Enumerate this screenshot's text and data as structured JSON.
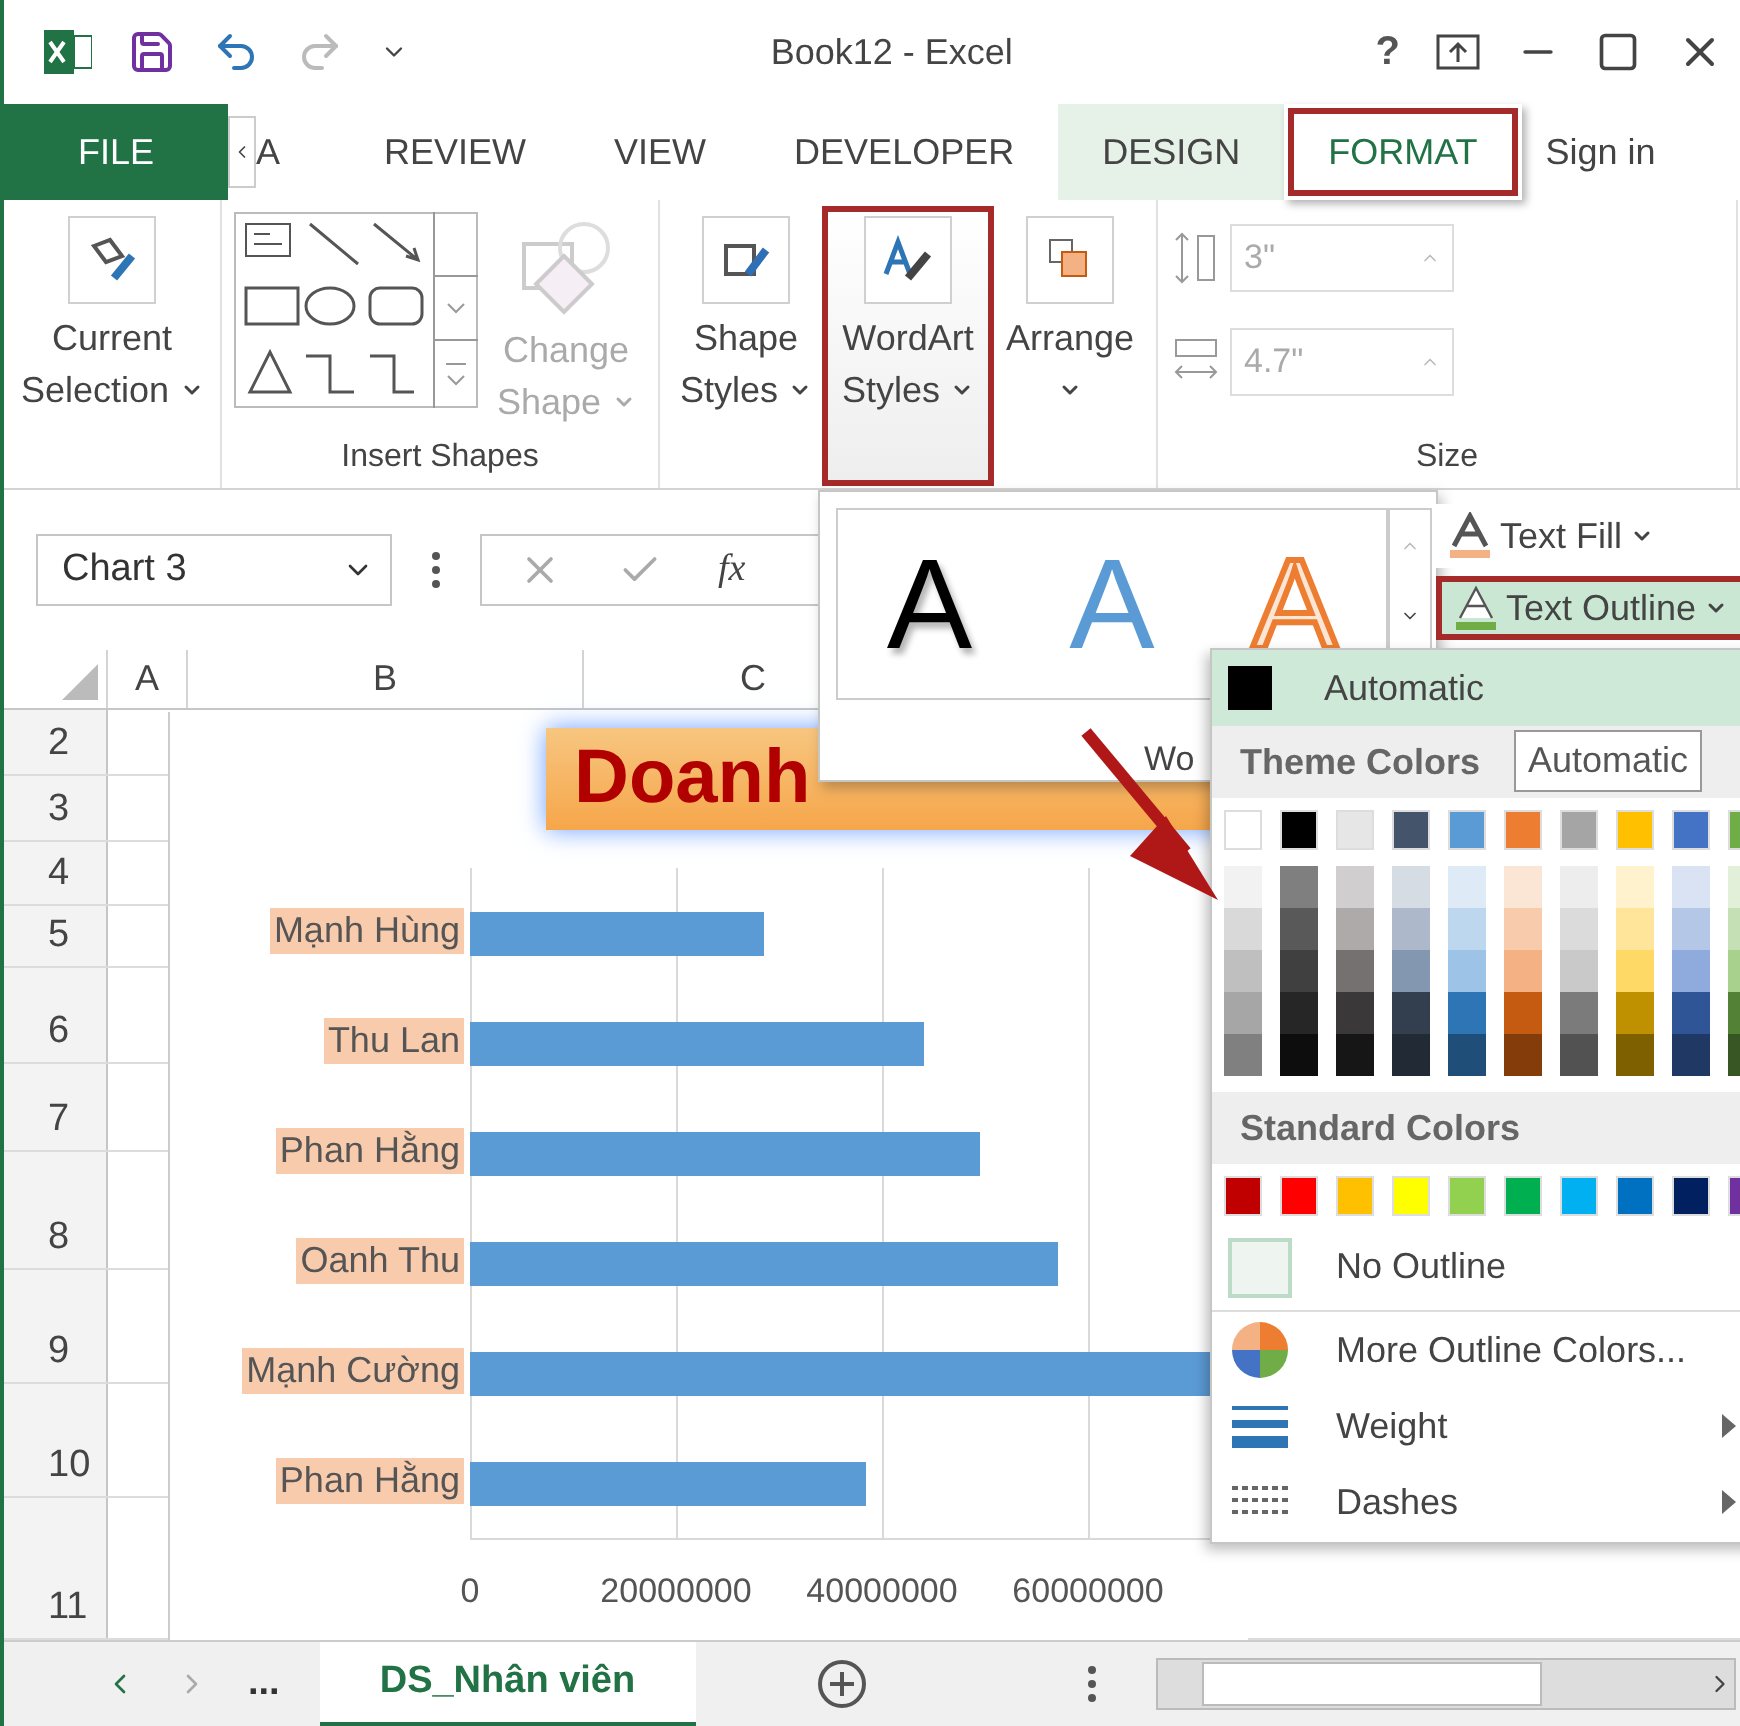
{
  "title_bar": {
    "title": "Book12 - Excel",
    "help": "?"
  },
  "tab_strip": {
    "file": "FILE",
    "cut_tab": "A",
    "sign_in": "Sign in",
    "tabs": [
      {
        "label": "REVIEW",
        "selected": false,
        "contextual": false,
        "highlighted": false
      },
      {
        "label": "VIEW",
        "selected": false,
        "contextual": false,
        "highlighted": false
      },
      {
        "label": "DEVELOPER",
        "selected": false,
        "contextual": false,
        "highlighted": false
      },
      {
        "label": "DESIGN",
        "selected": false,
        "contextual": true,
        "highlighted": false
      },
      {
        "label": "FORMAT",
        "selected": true,
        "contextual": true,
        "highlighted": true
      }
    ]
  },
  "ribbon": {
    "current_selection": {
      "label": "Current Selection"
    },
    "insert_shapes": {
      "label": "Insert Shapes",
      "change_shape": {
        "label": "Change Shape",
        "disabled": true
      }
    },
    "styles": [
      {
        "label": "Shape Styles",
        "highlighted": false
      },
      {
        "label": "WordArt Styles",
        "highlighted": true
      },
      {
        "label": "Arrange",
        "highlighted": false
      }
    ],
    "size": {
      "label": "Size",
      "height": "3\"",
      "width": "4.7\"",
      "disabled": true
    }
  },
  "formula_bar": {
    "name_box": "Chart 3",
    "fx": "fx"
  },
  "grid": {
    "columns": [
      "A",
      "B",
      "C"
    ],
    "rows": [
      "2",
      "3",
      "4",
      "5",
      "6",
      "7",
      "8",
      "9",
      "10",
      "11"
    ]
  },
  "chart": {
    "title": "Doanh",
    "chart_data": {
      "type": "bar",
      "orientation": "horizontal",
      "categories": [
        "Mạnh Hùng",
        "Thu Lan",
        "Phan Hằng",
        "Oanh Thu",
        "Mạnh Cường",
        "Phan Hằng"
      ],
      "values": [
        28500000,
        44000000,
        49500000,
        57000000,
        72000000,
        38500000
      ],
      "xticks": [
        0,
        20000000,
        40000000,
        60000000
      ],
      "xlim": [
        0,
        80000000
      ]
    }
  },
  "wordart_gallery": {
    "caption": "Wo",
    "samples": [
      {
        "text": "A",
        "kind": "fill"
      },
      {
        "text": "A",
        "kind": "gradient"
      },
      {
        "text": "A",
        "kind": "outline"
      }
    ]
  },
  "text_buttons": [
    {
      "label": "Text Fill",
      "kind": "fill",
      "highlighted": false
    },
    {
      "label": "Text Outline",
      "kind": "outline",
      "highlighted": true
    }
  ],
  "outline_menu": {
    "automatic": "Automatic",
    "theme_header": "Theme Colors",
    "tooltip": "Automatic",
    "theme_columns": [
      {
        "color": "#ffffff",
        "shades": [
          {
            "color": "#f2f2f2"
          },
          {
            "color": "#d9d9d9"
          },
          {
            "color": "#bfbfbf"
          },
          {
            "color": "#a6a6a6"
          },
          {
            "color": "#808080"
          }
        ]
      },
      {
        "color": "#000000",
        "shades": [
          {
            "color": "#7f7f7f"
          },
          {
            "color": "#595959"
          },
          {
            "color": "#404040"
          },
          {
            "color": "#262626"
          },
          {
            "color": "#0d0d0d"
          }
        ]
      },
      {
        "color": "#e7e6e6",
        "shades": [
          {
            "color": "#d0cece"
          },
          {
            "color": "#aeaaaa"
          },
          {
            "color": "#757171"
          },
          {
            "color": "#3a3838"
          },
          {
            "color": "#171616"
          }
        ]
      },
      {
        "color": "#44546a",
        "shades": [
          {
            "color": "#d6dce4"
          },
          {
            "color": "#adb9ca"
          },
          {
            "color": "#8497b0"
          },
          {
            "color": "#333f4f"
          },
          {
            "color": "#222a35"
          }
        ]
      },
      {
        "color": "#5b9bd5",
        "shades": [
          {
            "color": "#deebf6"
          },
          {
            "color": "#bdd7ee"
          },
          {
            "color": "#9dc3e6"
          },
          {
            "color": "#2e75b5"
          },
          {
            "color": "#1f4e79"
          }
        ]
      },
      {
        "color": "#ed7d31",
        "shades": [
          {
            "color": "#fbe5d5"
          },
          {
            "color": "#f7cbac"
          },
          {
            "color": "#f4b183"
          },
          {
            "color": "#c55a11"
          },
          {
            "color": "#843c0b"
          }
        ]
      },
      {
        "color": "#a5a5a5",
        "shades": [
          {
            "color": "#ededed"
          },
          {
            "color": "#dbdbdb"
          },
          {
            "color": "#c9c9c9"
          },
          {
            "color": "#7b7b7b"
          },
          {
            "color": "#525252"
          }
        ]
      },
      {
        "color": "#ffc000",
        "shades": [
          {
            "color": "#fff2cc"
          },
          {
            "color": "#fee599"
          },
          {
            "color": "#ffd965"
          },
          {
            "color": "#bf9000"
          },
          {
            "color": "#7f6000"
          }
        ]
      },
      {
        "color": "#4472c4",
        "shades": [
          {
            "color": "#dae3f3"
          },
          {
            "color": "#b4c7e7"
          },
          {
            "color": "#8faadc"
          },
          {
            "color": "#2f5597"
          },
          {
            "color": "#203864"
          }
        ]
      },
      {
        "color": "#70ad47",
        "shades": [
          {
            "color": "#e2f0d9"
          },
          {
            "color": "#c5e0b4"
          },
          {
            "color": "#a9d18e"
          },
          {
            "color": "#538135"
          },
          {
            "color": "#375623"
          }
        ]
      }
    ],
    "standard_header": "Standard Colors",
    "standard": [
      {
        "color": "#c00000"
      },
      {
        "color": "#ff0000"
      },
      {
        "color": "#ffc000"
      },
      {
        "color": "#ffff00"
      },
      {
        "color": "#92d050"
      },
      {
        "color": "#00b050"
      },
      {
        "color": "#00b0f0"
      },
      {
        "color": "#0070c0"
      },
      {
        "color": "#002060"
      },
      {
        "color": "#7030a0"
      }
    ],
    "no_outline": "No Outline",
    "items": [
      {
        "label": "More Outline Colors...",
        "submenu": false
      },
      {
        "label": "Weight",
        "submenu": true
      },
      {
        "label": "Dashes",
        "submenu": true
      }
    ]
  },
  "sheet_bar": {
    "more": "...",
    "tabs": [
      {
        "label": "DS_Nhân viên",
        "selected": true
      }
    ]
  }
}
